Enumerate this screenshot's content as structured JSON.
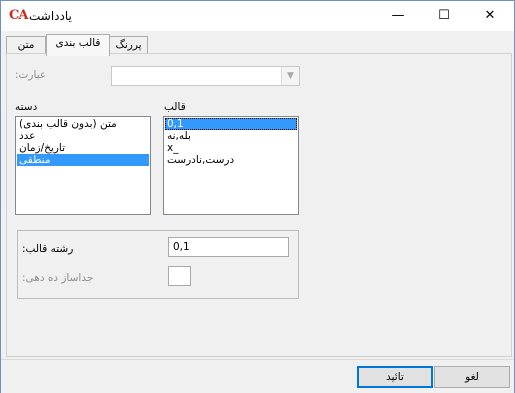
{
  "window": {
    "title": "یادداشت",
    "app_icon": "CA",
    "controls": {
      "minimize": "—",
      "maximize": "☐",
      "close": "✕"
    }
  },
  "tabs": [
    {
      "label": "متن"
    },
    {
      "label": "قالب بندی",
      "active": true
    },
    {
      "label": "پررنگ"
    }
  ],
  "expression": {
    "label": ":عبارت",
    "value": ""
  },
  "category": {
    "label": "دسته",
    "items": [
      "متن (بدون قالب بندی)",
      "عدد",
      "تاریخ/زمان",
      "منطقی"
    ],
    "selected_index": 3
  },
  "format": {
    "label": "قالب",
    "items": [
      "0,1",
      "بله,نه",
      "x_",
      "درست,نادرست"
    ],
    "selected_index": 0
  },
  "format_string": {
    "label": ":رشته قالب",
    "value": "0,1"
  },
  "decimal_separator": {
    "label": ":جداساز ده دهی",
    "value": ""
  },
  "buttons": {
    "ok": "تائید",
    "cancel": "لغو"
  },
  "colors": {
    "selection": "#3399ff",
    "default_border": "#0078d7",
    "icon_red": "#c42a1e"
  }
}
